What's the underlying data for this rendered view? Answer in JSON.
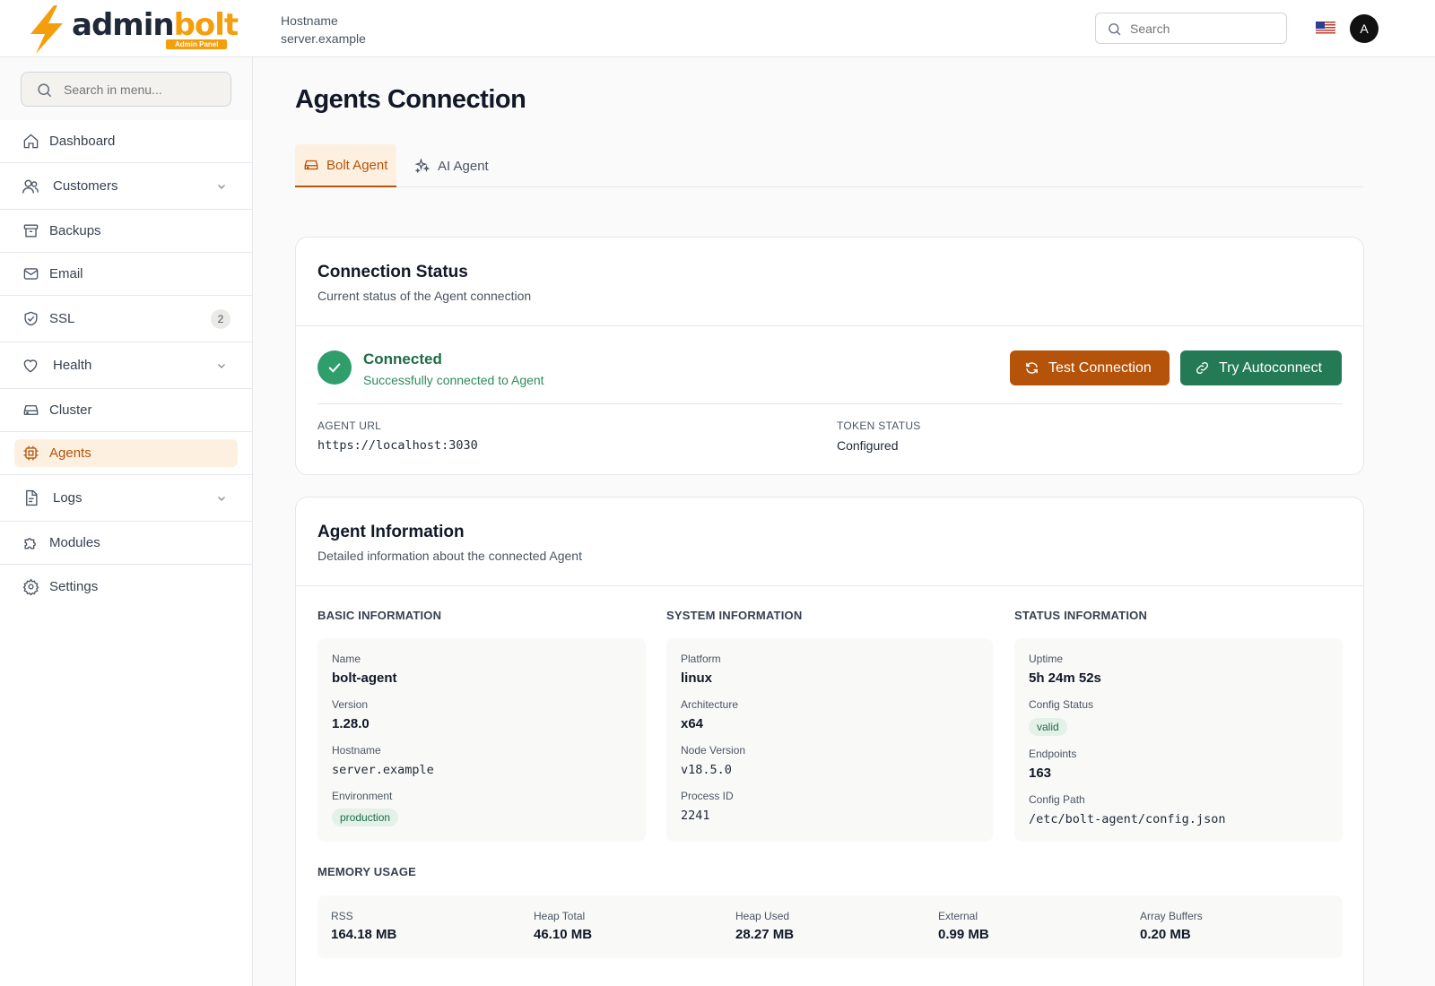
{
  "brand": {
    "name_part1": "admin",
    "name_part2": "bolt",
    "badge": "Admin Panel"
  },
  "header": {
    "hostname_label": "Hostname",
    "hostname_value": "server.example",
    "search_placeholder": "Search",
    "avatar_initial": "A"
  },
  "sidebar": {
    "search_placeholder": "Search in menu...",
    "items": [
      {
        "label": "Dashboard",
        "icon": "home-icon"
      },
      {
        "label": "Customers",
        "icon": "users-icon",
        "expandable": true
      },
      {
        "label": "Backups",
        "icon": "archive-icon"
      },
      {
        "label": "Email",
        "icon": "mail-icon"
      },
      {
        "label": "SSL",
        "icon": "shield-check-icon",
        "count": "2"
      },
      {
        "label": "Health",
        "icon": "heart-icon",
        "expandable": true
      },
      {
        "label": "Cluster",
        "icon": "server-icon"
      },
      {
        "label": "Agents",
        "icon": "cpu-icon",
        "active": true
      },
      {
        "label": "Logs",
        "icon": "file-text-icon",
        "expandable": true
      },
      {
        "label": "Modules",
        "icon": "puzzle-icon"
      },
      {
        "label": "Settings",
        "icon": "gear-icon"
      }
    ]
  },
  "page": {
    "title": "Agents Connection",
    "tabs": [
      {
        "label": "Bolt Agent",
        "icon": "server-icon",
        "active": true
      },
      {
        "label": "AI Agent",
        "icon": "sparkles-icon",
        "active": false
      }
    ]
  },
  "connection": {
    "title": "Connection Status",
    "subtitle": "Current status of the Agent connection",
    "status": "Connected",
    "status_detail": "Successfully connected to Agent",
    "test_button": "Test Connection",
    "autoconnect_button": "Try Autoconnect",
    "agent_url_label": "AGENT URL",
    "agent_url": "https://localhost:3030",
    "token_status_label": "TOKEN STATUS",
    "token_status": "Configured"
  },
  "agent_info": {
    "title": "Agent Information",
    "subtitle": "Detailed information about the connected Agent",
    "basic": {
      "heading": "BASIC INFORMATION",
      "name_label": "Name",
      "name": "bolt-agent",
      "version_label": "Version",
      "version": "1.28.0",
      "hostname_label": "Hostname",
      "hostname": "server.example",
      "environment_label": "Environment",
      "environment": "production"
    },
    "system": {
      "heading": "SYSTEM INFORMATION",
      "platform_label": "Platform",
      "platform": "linux",
      "architecture_label": "Architecture",
      "architecture": "x64",
      "node_version_label": "Node Version",
      "node_version": "v18.5.0",
      "process_id_label": "Process ID",
      "process_id": "2241"
    },
    "status": {
      "heading": "STATUS INFORMATION",
      "uptime_label": "Uptime",
      "uptime": "5h 24m 52s",
      "config_status_label": "Config Status",
      "config_status": "valid",
      "endpoints_label": "Endpoints",
      "endpoints": "163",
      "config_path_label": "Config Path",
      "config_path": "/etc/bolt-agent/config.json"
    },
    "memory": {
      "heading": "MEMORY USAGE",
      "items": [
        {
          "label": "RSS",
          "value": "164.18 MB"
        },
        {
          "label": "Heap Total",
          "value": "46.10 MB"
        },
        {
          "label": "Heap Used",
          "value": "28.27 MB"
        },
        {
          "label": "External",
          "value": "0.99 MB"
        },
        {
          "label": "Array Buffers",
          "value": "0.20 MB"
        }
      ]
    }
  },
  "colors": {
    "accent": "#b45309",
    "brand_orange": "#f59e0b",
    "success": "#247a55"
  }
}
